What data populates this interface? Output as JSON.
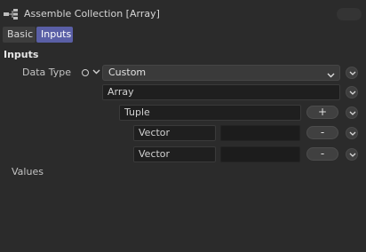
{
  "window": {
    "title": "Assemble Collection [Array]",
    "title_icon": "node-collection-icon"
  },
  "tabs": [
    {
      "label": "Basic",
      "active": false
    },
    {
      "label": "Inputs",
      "active": true
    }
  ],
  "inputs": {
    "heading": "Inputs",
    "data_type_label": "Data Type",
    "data_type_value": "Custom",
    "array_label": "Array",
    "tuple_label": "Tuple",
    "add_button": "+",
    "remove_button": "-",
    "vectors": [
      {
        "label": "Vector",
        "value": ""
      },
      {
        "label": "Vector",
        "value": ""
      }
    ],
    "values_label": "Values"
  },
  "colors": {
    "background": "#2b2b2b",
    "active_tab": "#5a5fa6",
    "field": "#1f1f1f"
  }
}
